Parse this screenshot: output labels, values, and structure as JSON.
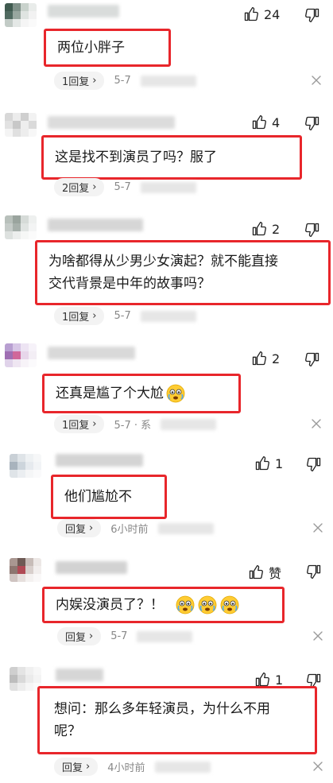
{
  "comments": [
    {
      "text": "两位小胖子",
      "likes": "24",
      "reply": "1回复",
      "date": "5-7"
    },
    {
      "text": "这是找不到演员了吗？服了",
      "likes": "4",
      "reply": "2回复",
      "date": "5-7"
    },
    {
      "text_line1": "为啥都得从少男少女演起？就不能直接",
      "text_line2": "交代背景是中年的故事吗？",
      "likes": "2",
      "reply": "1回复",
      "date": "5-7"
    },
    {
      "text": "还真是尴了个大尬",
      "likes": "2",
      "reply": "1回复",
      "date": "5-7 · 系"
    },
    {
      "text": "他们尴尬不",
      "likes": "1",
      "reply": "回复",
      "date": "6小时前"
    },
    {
      "text": "内娱没演员了？！",
      "likes": "赞",
      "reply": "回复",
      "date": "5-7"
    },
    {
      "text_line1": "想问：那么多年轻演员，为什么不用",
      "text_line2": "呢？",
      "likes": "1",
      "reply": "回复",
      "date": "4小时前"
    }
  ],
  "icons": {
    "like": "thumbs-up-icon",
    "dislike": "thumbs-down-icon",
    "close": "close-icon",
    "chevron": "chevron-right-icon",
    "emoji": "crying-face-emoji"
  },
  "colors": {
    "highlight": "#e8262b",
    "muted": "#888888"
  }
}
